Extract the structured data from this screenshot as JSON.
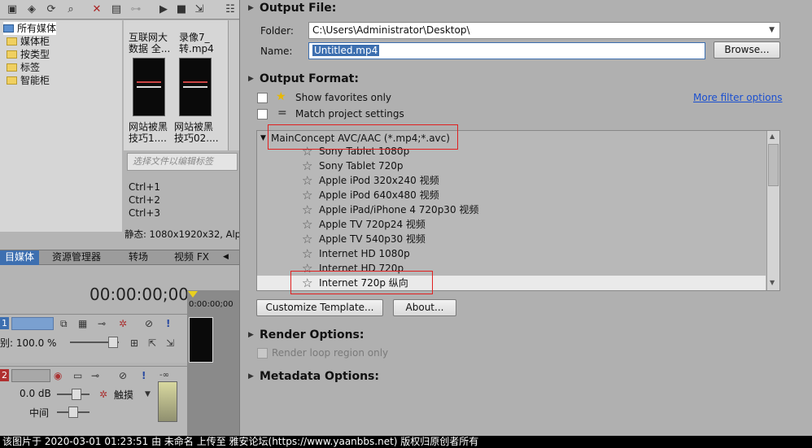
{
  "left": {
    "tree": [
      "所有媒体",
      "媒体柜",
      "按类型",
      "标签",
      "智能柜"
    ],
    "thumbs": [
      {
        "title_line1": "互联网大",
        "title_line2": "数据 全...",
        "name_line1": "网站被黑",
        "name_line2": "技巧1...."
      },
      {
        "title_line1": "录像7_",
        "title_line2": "转.mp4",
        "name_line1": "网站被黑",
        "name_line2": "技巧02...."
      }
    ],
    "tag_placeholder": "选择文件以编辑标签",
    "shortcuts": [
      "Ctrl+1",
      "Ctrl+2",
      "Ctrl+3"
    ],
    "status": "静态: 1080x1920x32, Alp",
    "tabs": [
      "目媒体",
      "资源管理器",
      "转场",
      "视频 FX"
    ],
    "timecode": "00:00:00;00",
    "ruler_time": "0:00:00;00",
    "track1": {
      "num": "1",
      "level": "别: 100.0 %"
    },
    "track2": {
      "num": "2",
      "volume": "0.0 dB",
      "pan": "中间",
      "mode": "触摸",
      "db_marks": "-∞"
    }
  },
  "right": {
    "output_file": {
      "heading": "Output File:",
      "folder_label": "Folder:",
      "folder_value": "C:\\Users\\Administrator\\Desktop\\",
      "name_label": "Name:",
      "name_value": "Untitled.mp4",
      "browse": "Browse..."
    },
    "output_format": {
      "heading": "Output Format:",
      "show_favorites": "Show favorites only",
      "match_settings": "Match project settings",
      "more_filter": "More filter options",
      "group": "MainConcept AVC/AAC (*.mp4;*.avc)",
      "items": [
        "Sony Tablet 1080p",
        "Sony Tablet 720p",
        "Apple iPod 320x240 视频",
        "Apple iPod 640x480 视频",
        "Apple iPad/iPhone 4 720p30 视频",
        "Apple TV 720p24 视频",
        "Apple TV 540p30 视频",
        "Internet HD 1080p",
        "Internet HD 720p",
        "Internet 720p 纵向"
      ],
      "selected_index": 9,
      "customize": "Customize Template...",
      "about": "About..."
    },
    "render_options": {
      "heading": "Render Options:",
      "loop": "Render loop region only"
    },
    "metadata_options": {
      "heading": "Metadata Options:"
    }
  },
  "footer": "该图片于 2020-03-01 01:23:51 由 未命名 上传至 雅安论坛(https://www.yaanbbs.net) 版权归原创者所有",
  "colors": {
    "accent": "#3d6fb0",
    "highlight": "#e02020",
    "link": "#1a4fd0"
  }
}
